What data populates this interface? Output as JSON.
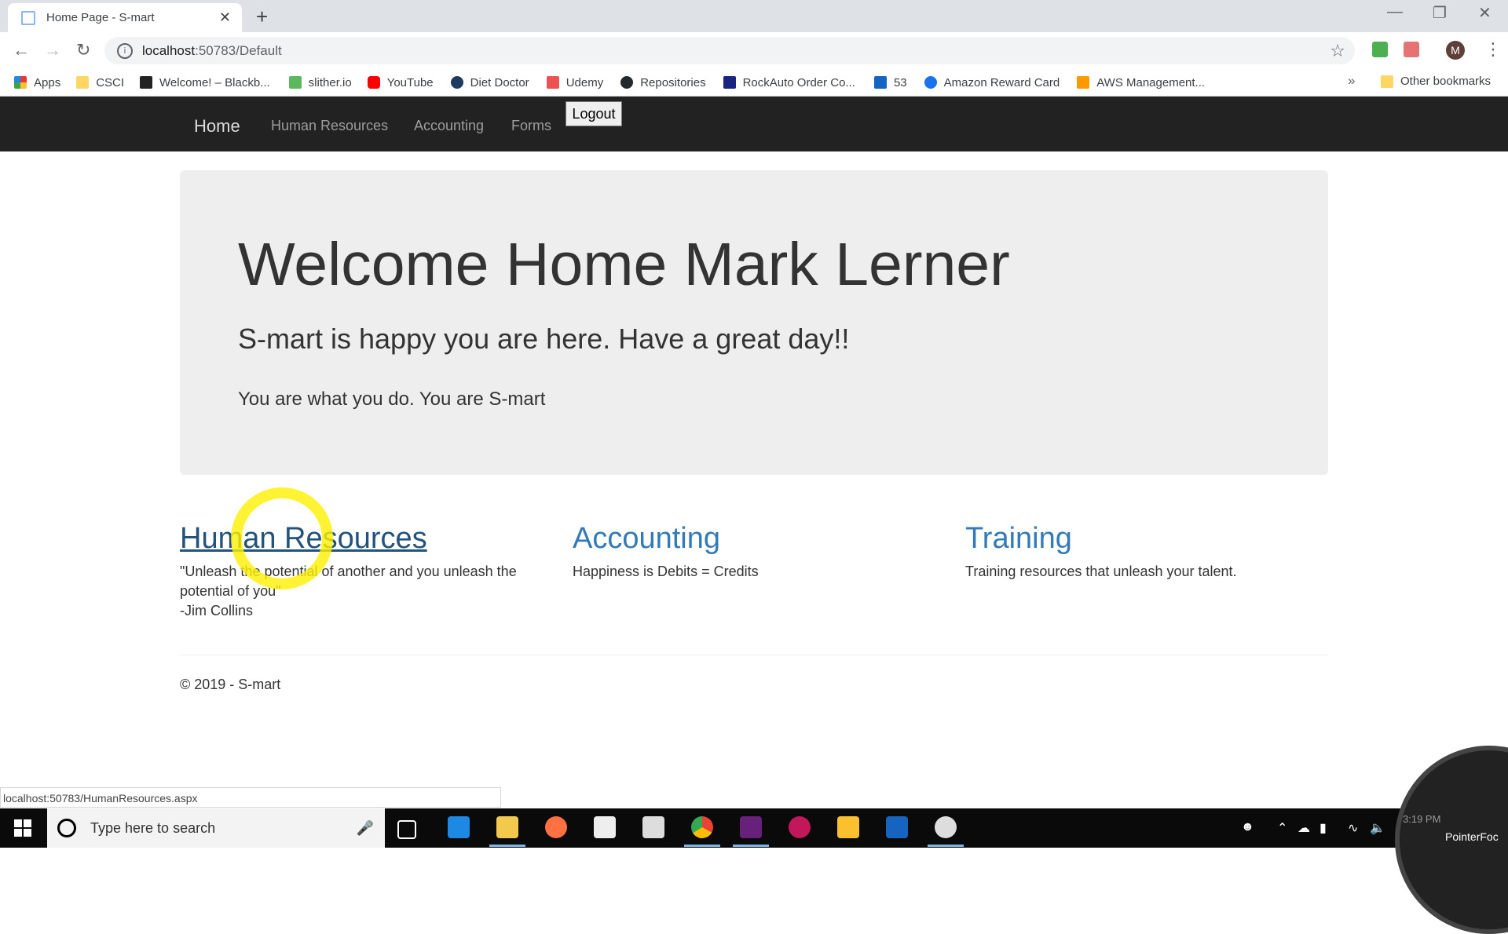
{
  "browser": {
    "tab_title": "Home Page - S-mart",
    "tab_close": "✕",
    "new_tab": "+",
    "url_host": "localhost",
    "url_rest": ":50783/Default",
    "window_controls": {
      "minimize": "—",
      "restore": "❐",
      "close": "✕"
    },
    "avatar_letter": "M",
    "bookmarks": [
      {
        "label": "Apps",
        "color": "#e53935"
      },
      {
        "label": "CSCI",
        "color": "#fdd663"
      },
      {
        "label": "Welcome! – Blackb...",
        "color": "#222222"
      },
      {
        "label": "slither.io",
        "color": "#5cb85c"
      },
      {
        "label": "YouTube",
        "color": "#ff0000"
      },
      {
        "label": "Diet Doctor",
        "color": "#1e3a5f"
      },
      {
        "label": "Udemy",
        "color": "#ec5252"
      },
      {
        "label": "Repositories",
        "color": "#24292e"
      },
      {
        "label": "RockAuto Order Co...",
        "color": "#1a237e"
      },
      {
        "label": "53",
        "color": "#1565c0"
      },
      {
        "label": "Amazon Reward Card",
        "color": "#1a73e8"
      },
      {
        "label": "AWS Management...",
        "color": "#ff9900"
      }
    ],
    "bookmarks_overflow": "»",
    "other_bookmarks": "Other bookmarks",
    "status_url": "localhost:50783/HumanResources.aspx"
  },
  "nav": {
    "brand": "Home",
    "items": [
      "Human Resources",
      "Accounting",
      "Forms"
    ],
    "logout": "Logout"
  },
  "jumbotron": {
    "heading": "Welcome Home Mark Lerner",
    "subheading": "S-mart is happy you are here. Have a great day!!",
    "text": "You are what you do. You are S-mart"
  },
  "columns": [
    {
      "title": "Human Resources",
      "lines": [
        "\"Unleash the potential of another and you unleash the potential of you\"",
        "-Jim Collins"
      ]
    },
    {
      "title": "Accounting",
      "lines": [
        "Happiness is Debits = Credits"
      ]
    },
    {
      "title": "Training",
      "lines": [
        "Training resources that unleash your talent."
      ]
    }
  ],
  "footer": "© 2019 - S-mart",
  "taskbar": {
    "search_placeholder": "Type here to search",
    "time": "3:19 PM",
    "pointer_label": "PointerFoc"
  }
}
